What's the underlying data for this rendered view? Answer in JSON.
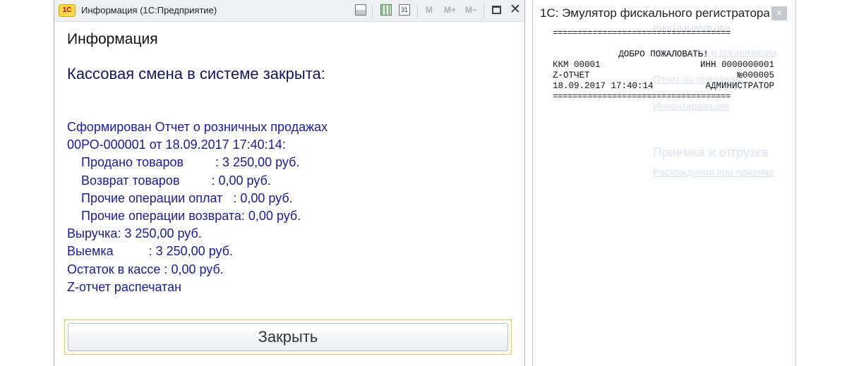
{
  "info_window": {
    "logo_text": "1С",
    "title": "Информация  (1С:Предприятие)",
    "calendar_icon_text": "31",
    "memory_buttons": [
      "M",
      "M+",
      "M−"
    ],
    "heading": "Информация",
    "subheading": "Кассовая смена в системе закрыта:",
    "report_lines": [
      "Сформирован Отчет о розничных продажах",
      "00РО-000001 от 18.09.2017 17:40:14:",
      "Продано товаров         : 3 250,00 руб.",
      "Возврат товаров         : 0,00 руб.",
      "Прочие операции оплат   : 0,00 руб.",
      "Прочие операции возврата: 0,00 руб.",
      "Выручка: 3 250,00 руб.",
      "Выемка          : 3 250,00 руб.",
      "Остаток в кассе : 0,00 руб.",
      "Z-отчет распечатан"
    ],
    "close_button_label": "Закрыть"
  },
  "emulator_window": {
    "title": "1С: Эмулятор фискального регистратора",
    "close_glyph": "×",
    "receipt": {
      "separator": "====================================",
      "welcome": "ДОБРО ПОЖАЛОВАТЬ!",
      "kkm": "ККМ 00001",
      "inn": "ИНН 0000000001",
      "report_type": "Z-ОТЧЕТ",
      "report_number": "№000005",
      "datetime": "18.09.2017 17:40:14",
      "operator": "АДМИНИСТРАТОР"
    }
  },
  "background_panel": {
    "items": [
      "Информация",
      "Маркировка и организации",
      "Отчет по продажам",
      "Инвентаризация",
      "Приемка и отгрузка",
      "Расхождения при приемке"
    ]
  },
  "colors": {
    "report_text": "#1a1aa0",
    "subheading": "#141466",
    "ghost_text": "#dce5f1"
  }
}
